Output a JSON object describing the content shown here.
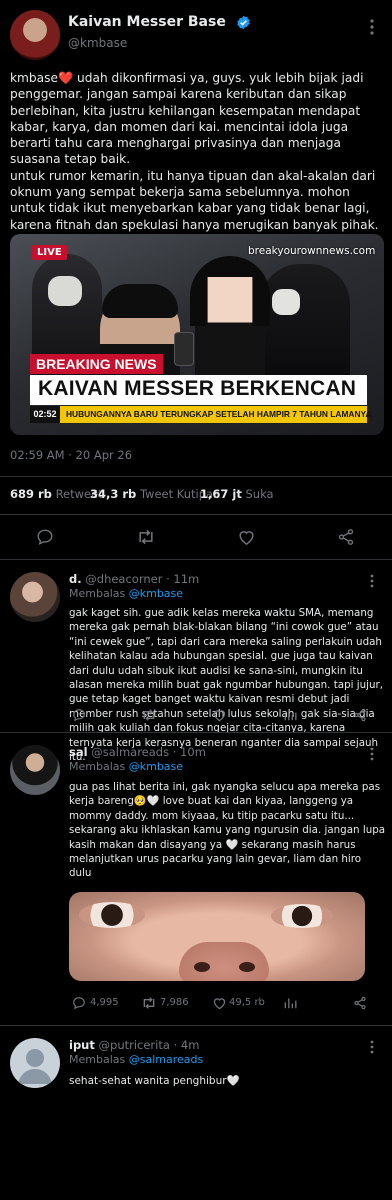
{
  "main_post": {
    "author_name": "Kaivan Messer Base",
    "author_handle": "@kmbase",
    "paragraph1": "kmbase❤️  udah dikonfirmasi ya, guys. yuk lebih bijak jadi penggemar. jangan sampai karena keributan dan sikap berlebihan, kita justru kehilangan kesempatan mendapat kabar, karya, dan momen dari kai. mencintai idola juga berarti tahu cara menghargai privasinya dan menjaga suasana tetap baik.",
    "paragraph2": "untuk rumor kemarin, itu hanya tipuan dan akal-akalan dari oknum yang sempat bekerja sama sebelumnya. mohon untuk tidak ikut menyebarkan kabar yang tidak benar lagi, karena fitnah dan spekulasi hanya merugikan banyak pihak.",
    "news": {
      "live": "LIVE",
      "site": "breakyourownnews.com",
      "breaking": "BREAKING NEWS",
      "headline": "KAIVAN MESSER BERKENCAN",
      "time": "02:52",
      "ticker": "HUBUNGANNYA BARU TERUNGKAP SETELAH HAMPIR 7 TAHUN LAMANYA."
    },
    "timestamp": "02:59 AM · 20 Apr 26",
    "stats": {
      "retweets_count": "689 rb",
      "retweets_label": "Retweet",
      "quotes_count": "34,3 rb",
      "quotes_label": "Tweet Kutipan",
      "likes_count": "1,67 jt",
      "likes_label": "Suka"
    }
  },
  "replies": [
    {
      "name": "d.",
      "handle": "@dheacorner",
      "time": "· 11m",
      "reply_prefix": "Membalas",
      "reply_to": "@kmbase",
      "text": "gak kaget sih. gue adik kelas mereka waktu SMA, memang mereka gak pernah blak-blakan bilang “ini cowok gue” atau “ini cewek gue”, tapi dari cara mereka saling perlakuin udah kelihatan kalau ada hubungan spesial. gue juga tau kaivan dari dulu udah sibuk ikut audisi ke sana-sini, mungkin itu alasan mereka milih buat gak ngumbar hubungan. tapi jujur, gue tetap kaget banget waktu kaivan resmi debut jadi member rush setahun setelah lulus sekolah. gak sia-sia dia milih gak kuliah dan fokus ngejar cita-citanya, karena ternyata kerja kerasnya beneran nganter dia sampai sejauh itu."
    },
    {
      "name": "sal",
      "handle": "@salmareads",
      "time": "· 10m",
      "reply_prefix": "Membalas",
      "reply_to": "@kmbase",
      "text": "gua pas lihat berita ini, gak nyangka selucu apa mereka pas kerja bareng🥺🤍 love buat kai dan kiyaa, langgeng ya mommy daddy. mom kiyaaa, ku titip pacarku satu itu... sekarang aku ikhlaskan kamu yang ngurusin dia. jangan lupa kasih makan dan disayang ya 🤍 sekarang masih harus melanjutkan urus pacarku yang lain gevar, liam dan hiro dulu",
      "comments": "4,995",
      "retweets": "7,986",
      "likes": "49,5 rb"
    },
    {
      "name": "iput",
      "handle": "@putricerita",
      "time": "· 4m",
      "reply_prefix": "Membalas",
      "reply_to": "@salmareads",
      "text": "sehat-sehat wanita penghibur🤍"
    }
  ]
}
